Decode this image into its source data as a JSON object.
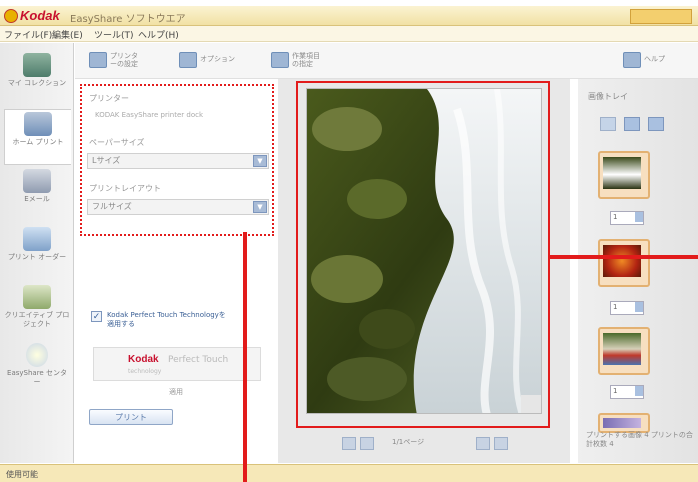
{
  "window": {
    "brand": "Kodak",
    "title": "EasyShare ソフトウエア"
  },
  "menu": [
    "ファイル(F)",
    "編集(E)",
    "ツール(T)",
    "ヘルプ(H)"
  ],
  "nav": [
    {
      "label": "マイ コレクション"
    },
    {
      "label": "ホーム プリント"
    },
    {
      "label": "Eメール"
    },
    {
      "label": "プリント オーダー"
    },
    {
      "label": "クリエイティブ プロジェクト"
    },
    {
      "label": "EasyShare センター"
    }
  ],
  "toolbar": {
    "printer_settings": "プリンターの設定",
    "options": "オプション",
    "work_items": "作業項目の指定",
    "help": "ヘルプ"
  },
  "settings": {
    "printer_label": "プリンター",
    "printer_value": "KODAK EasyShare printer dock",
    "paper_size_label": "ペーパーサイズ",
    "paper_size_value": "Lサイズ",
    "layout_label": "プリントレイアウト",
    "layout_value": "フルサイズ",
    "perfect_touch_label": "Kodak Perfect Touch Technologyを適用する",
    "perfect_touch_logo_brand": "Kodak",
    "perfect_touch_logo_text": "Perfect Touch",
    "perfect_touch_sub": "technology",
    "perfect_touch_apply": "適用",
    "print_button": "プリント"
  },
  "preview": {
    "page_indicator": "1/1ページ"
  },
  "tray": {
    "title": "画像トレイ",
    "items": [
      {
        "qty": "1",
        "name": "waterfall"
      },
      {
        "qty": "1",
        "name": "red-flower"
      },
      {
        "qty": "1",
        "name": "boats"
      }
    ],
    "footer": "プリントする画像 4 プリントの合計枚数 4"
  },
  "status": {
    "text": "使用可能"
  },
  "colors": {
    "annotation_red": "#e21b1b",
    "accent_blue": "#6f8fb8",
    "kodak_red": "#c8102e",
    "kodak_yellow": "#e8b100"
  }
}
